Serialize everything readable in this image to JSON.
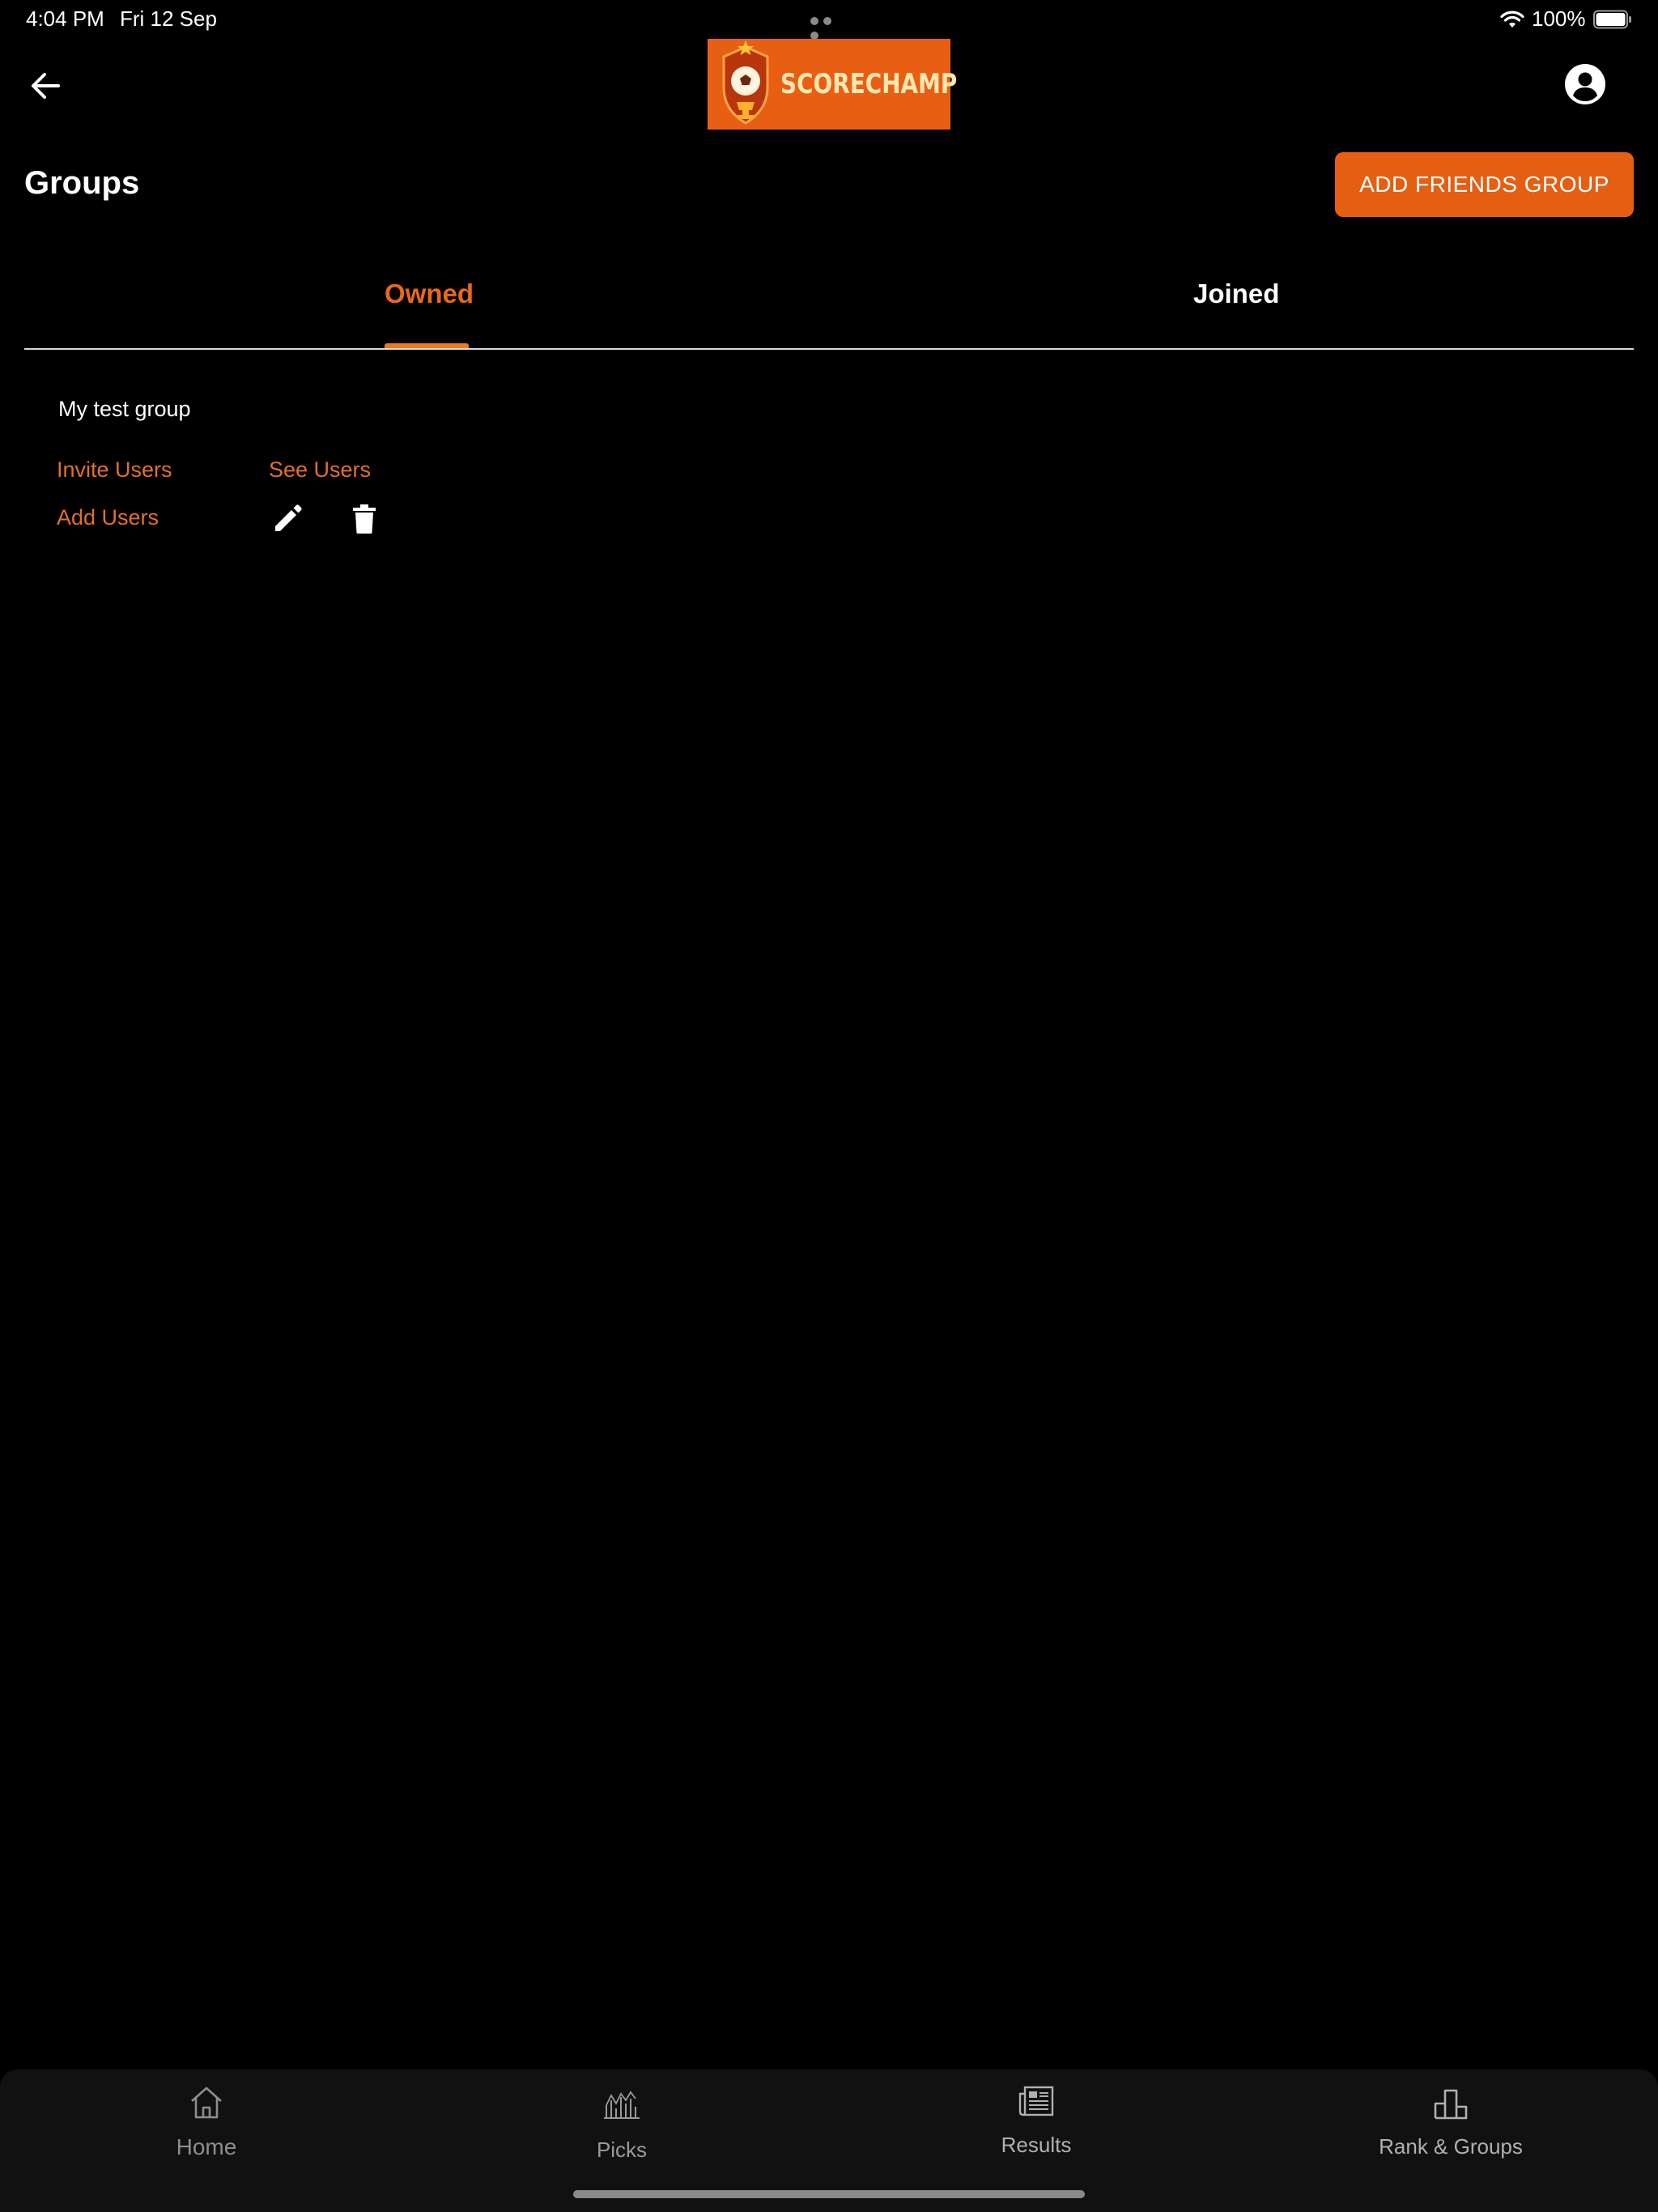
{
  "status_bar": {
    "time": "4:04 PM",
    "date": "Fri 12 Sep",
    "battery": "100%",
    "icons": [
      "wifi-icon",
      "battery-icon",
      "more-dots-icon"
    ]
  },
  "header": {
    "back_icon": "arrow-left-icon",
    "logo_text": "SCORECHAMP",
    "profile_icon": "account-circle-icon"
  },
  "page": {
    "title": "Groups",
    "add_button_label": "ADD FRIENDS GROUP"
  },
  "tabs": [
    {
      "label": "Owned",
      "active": true
    },
    {
      "label": "Joined",
      "active": false
    }
  ],
  "groups": [
    {
      "name": "My test group",
      "actions": {
        "invite_label": "Invite Users",
        "see_label": "See Users",
        "add_label": "Add Users",
        "edit_icon": "pencil-icon",
        "delete_icon": "trash-icon"
      }
    }
  ],
  "bottom_nav": [
    {
      "label": "Home",
      "icon": "home-icon"
    },
    {
      "label": "Picks",
      "icon": "picks-chart-icon"
    },
    {
      "label": "Results",
      "icon": "newspaper-icon"
    },
    {
      "label": "Rank & Groups",
      "icon": "podium-icon"
    }
  ],
  "colors": {
    "accent": "#e55f13",
    "link": "#e0702a",
    "background": "#000000",
    "nav_background": "#111111"
  }
}
